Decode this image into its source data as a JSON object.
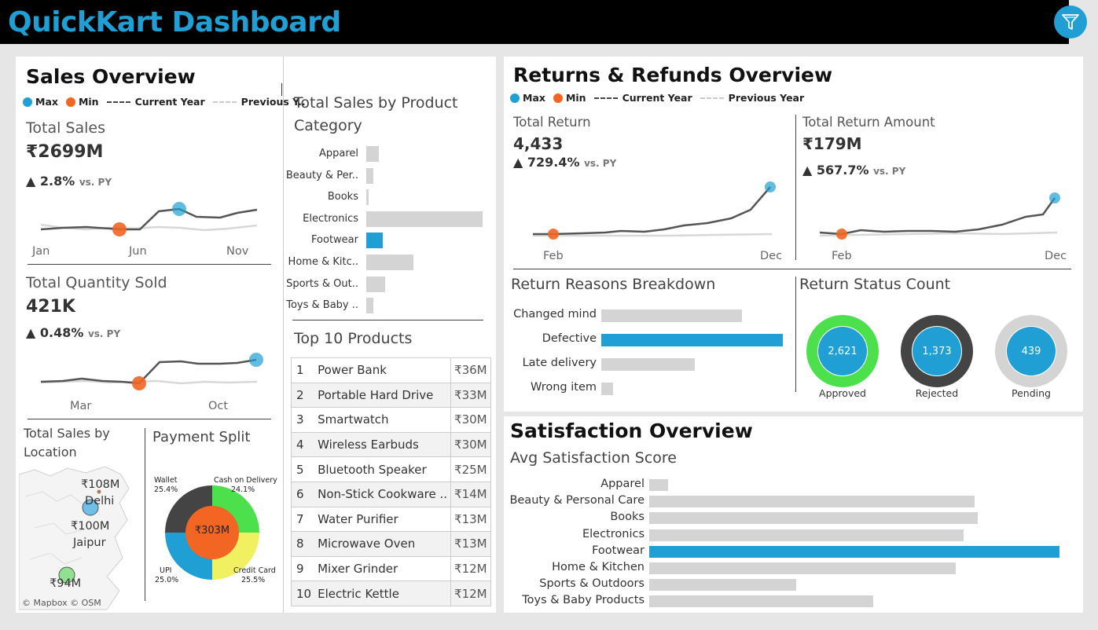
{
  "header": {
    "title": "QuickKart Dashboard"
  },
  "icons": {
    "filter": "filter-funnel-icon"
  },
  "colors": {
    "accent": "#1f9fd3",
    "max": "#1f9fd3",
    "min": "#f26522",
    "bar": "#d4d4d4",
    "approved": "#4ce04c",
    "rejected": "#444444",
    "pending": "#d4d4d4",
    "pie_center": "#f26522",
    "pie_yellow": "#f0f060"
  },
  "legend": {
    "max": "Max",
    "min": "Min",
    "current": "Current Year",
    "previous_short": "Previous Y..",
    "previous": "Previous Year"
  },
  "sales": {
    "title": "Sales Overview",
    "total_sales": {
      "label": "Total Sales",
      "value": "₹2699M",
      "delta": "▲ 2.8%",
      "vs": "vs. PY",
      "ticks": [
        "Jan",
        "Jun",
        "Nov"
      ]
    },
    "total_qty": {
      "label": "Total Quantity Sold",
      "value": "421K",
      "delta": "▲ 0.48%",
      "vs": "vs. PY",
      "ticks": [
        "Mar",
        "Oct"
      ]
    },
    "location": {
      "title": "Total Sales by Location",
      "points": [
        {
          "value": "₹108M",
          "city": "Delhi"
        },
        {
          "value": "₹100M",
          "city": "Jaipur"
        },
        {
          "value": "₹94M",
          "city": ""
        }
      ],
      "credit": "© Mapbox © OSM"
    },
    "payment": {
      "title": "Payment Split",
      "center": "₹303M",
      "slices": [
        {
          "name": "Wallet",
          "pct": "25.4%"
        },
        {
          "name": "Cash on Delivery",
          "pct": "24.1%"
        },
        {
          "name": "Credit Card",
          "pct": "25.5%"
        },
        {
          "name": "UPI",
          "pct": "25.0%"
        }
      ]
    }
  },
  "category": {
    "title": "Total Sales by Product Category",
    "items": [
      {
        "label": "Apparel",
        "value": 16,
        "hl": false
      },
      {
        "label": "Beauty & Per..",
        "value": 9,
        "hl": false
      },
      {
        "label": "Books",
        "value": 3,
        "hl": false
      },
      {
        "label": "Electronics",
        "value": 148,
        "hl": false
      },
      {
        "label": "Footwear",
        "value": 21,
        "hl": true
      },
      {
        "label": "Home & Kitc..",
        "value": 60,
        "hl": false
      },
      {
        "label": "Sports & Out..",
        "value": 24,
        "hl": false
      },
      {
        "label": "Toys & Baby ..",
        "value": 9,
        "hl": false
      }
    ]
  },
  "top10": {
    "title": "Top 10 Products",
    "rows": [
      {
        "rank": "1",
        "name": "Power Bank",
        "value": "₹36M"
      },
      {
        "rank": "2",
        "name": "Portable Hard Drive",
        "value": "₹33M"
      },
      {
        "rank": "3",
        "name": "Smartwatch",
        "value": "₹30M"
      },
      {
        "rank": "4",
        "name": "Wireless Earbuds",
        "value": "₹30M"
      },
      {
        "rank": "5",
        "name": "Bluetooth Speaker",
        "value": "₹25M"
      },
      {
        "rank": "6",
        "name": "Non-Stick Cookware ..",
        "value": "₹14M"
      },
      {
        "rank": "7",
        "name": "Water Purifier",
        "value": "₹13M"
      },
      {
        "rank": "8",
        "name": "Microwave Oven",
        "value": "₹13M"
      },
      {
        "rank": "9",
        "name": "Mixer Grinder",
        "value": "₹12M"
      },
      {
        "rank": "10",
        "name": "Electric Kettle",
        "value": "₹12M"
      }
    ]
  },
  "returns": {
    "title": "Returns & Refunds Overview",
    "total_return": {
      "label": "Total Return",
      "value": "4,433",
      "delta": "▲ 729.4%",
      "vs": "vs. PY",
      "ticks": [
        "Feb",
        "Dec"
      ]
    },
    "total_amount": {
      "label": "Total Return Amount",
      "value": "₹179M",
      "delta": "▲ 567.7%",
      "vs": "vs. PY",
      "ticks": [
        "Feb",
        "Dec"
      ]
    },
    "reasons": {
      "title": "Return Reasons Breakdown",
      "items": [
        {
          "label": "Changed mind",
          "value": 179,
          "hl": false
        },
        {
          "label": "Defective",
          "value": 231,
          "hl": true
        },
        {
          "label": "Late delivery",
          "value": 119,
          "hl": false
        },
        {
          "label": "Wrong item",
          "value": 15,
          "hl": false
        }
      ]
    },
    "status": {
      "title": "Return Status Count",
      "items": [
        {
          "label": "Approved",
          "value": "2,621"
        },
        {
          "label": "Rejected",
          "value": "1,373"
        },
        {
          "label": "Pending",
          "value": "439"
        }
      ]
    }
  },
  "satisfaction": {
    "title": "Satisfaction Overview",
    "subtitle": "Avg Satisfaction Score",
    "items": [
      {
        "label": "Apparel",
        "value": 24,
        "hl": false
      },
      {
        "label": "Beauty & Personal Care",
        "value": 414,
        "hl": false
      },
      {
        "label": "Books",
        "value": 418,
        "hl": false
      },
      {
        "label": "Electronics",
        "value": 400,
        "hl": false
      },
      {
        "label": "Footwear",
        "value": 522,
        "hl": true
      },
      {
        "label": "Home & Kitchen",
        "value": 390,
        "hl": false
      },
      {
        "label": "Sports & Outdoors",
        "value": 187,
        "hl": false
      },
      {
        "label": "Toys & Baby Products",
        "value": 285,
        "hl": false
      }
    ]
  }
}
